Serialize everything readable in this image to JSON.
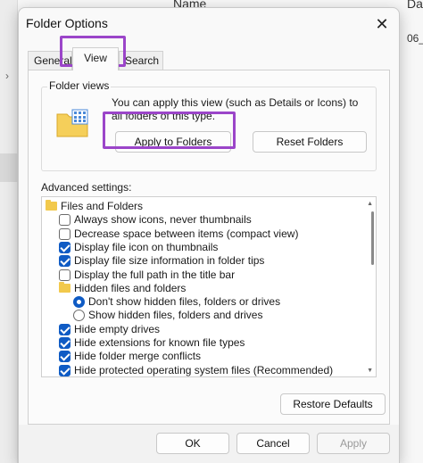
{
  "background": {
    "col_name": "Name",
    "col_date": "Da",
    "date_cell": "06_",
    "chevron": "›"
  },
  "dialog": {
    "title": "Folder Options",
    "close_glyph": "✕",
    "tabs": [
      {
        "label": "General"
      },
      {
        "label": "View"
      },
      {
        "label": "Search"
      }
    ],
    "folder_views": {
      "group_label": "Folder views",
      "description": "You can apply this view (such as Details or Icons) to all folders of this type.",
      "apply_label": "Apply to Folders",
      "reset_label": "Reset Folders"
    },
    "advanced": {
      "label": "Advanced settings:",
      "items": [
        {
          "type": "folder",
          "label": "Files and Folders",
          "indent": 0
        },
        {
          "type": "checkbox",
          "label": "Always show icons, never thumbnails",
          "checked": false,
          "indent": 1
        },
        {
          "type": "checkbox",
          "label": "Decrease space between items (compact view)",
          "checked": false,
          "indent": 1
        },
        {
          "type": "checkbox",
          "label": "Display file icon on thumbnails",
          "checked": true,
          "indent": 1
        },
        {
          "type": "checkbox",
          "label": "Display file size information in folder tips",
          "checked": true,
          "indent": 1
        },
        {
          "type": "checkbox",
          "label": "Display the full path in the title bar",
          "checked": false,
          "indent": 1
        },
        {
          "type": "folder",
          "label": "Hidden files and folders",
          "indent": 1
        },
        {
          "type": "radio",
          "label": "Don't show hidden files, folders or drives",
          "checked": true,
          "indent": 2
        },
        {
          "type": "radio",
          "label": "Show hidden files, folders and drives",
          "checked": false,
          "indent": 2
        },
        {
          "type": "checkbox",
          "label": "Hide empty drives",
          "checked": true,
          "indent": 1
        },
        {
          "type": "checkbox",
          "label": "Hide extensions for known file types",
          "checked": true,
          "indent": 1
        },
        {
          "type": "checkbox",
          "label": "Hide folder merge conflicts",
          "checked": true,
          "indent": 1
        },
        {
          "type": "checkbox",
          "label": "Hide protected operating system files (Recommended)",
          "checked": true,
          "indent": 1
        }
      ]
    },
    "restore_label": "Restore Defaults",
    "footer": {
      "ok_label": "OK",
      "cancel_label": "Cancel",
      "apply_label": "Apply"
    }
  },
  "colors": {
    "highlight": "#9b45c9",
    "checkbox_accent": "#0f5bc4"
  }
}
